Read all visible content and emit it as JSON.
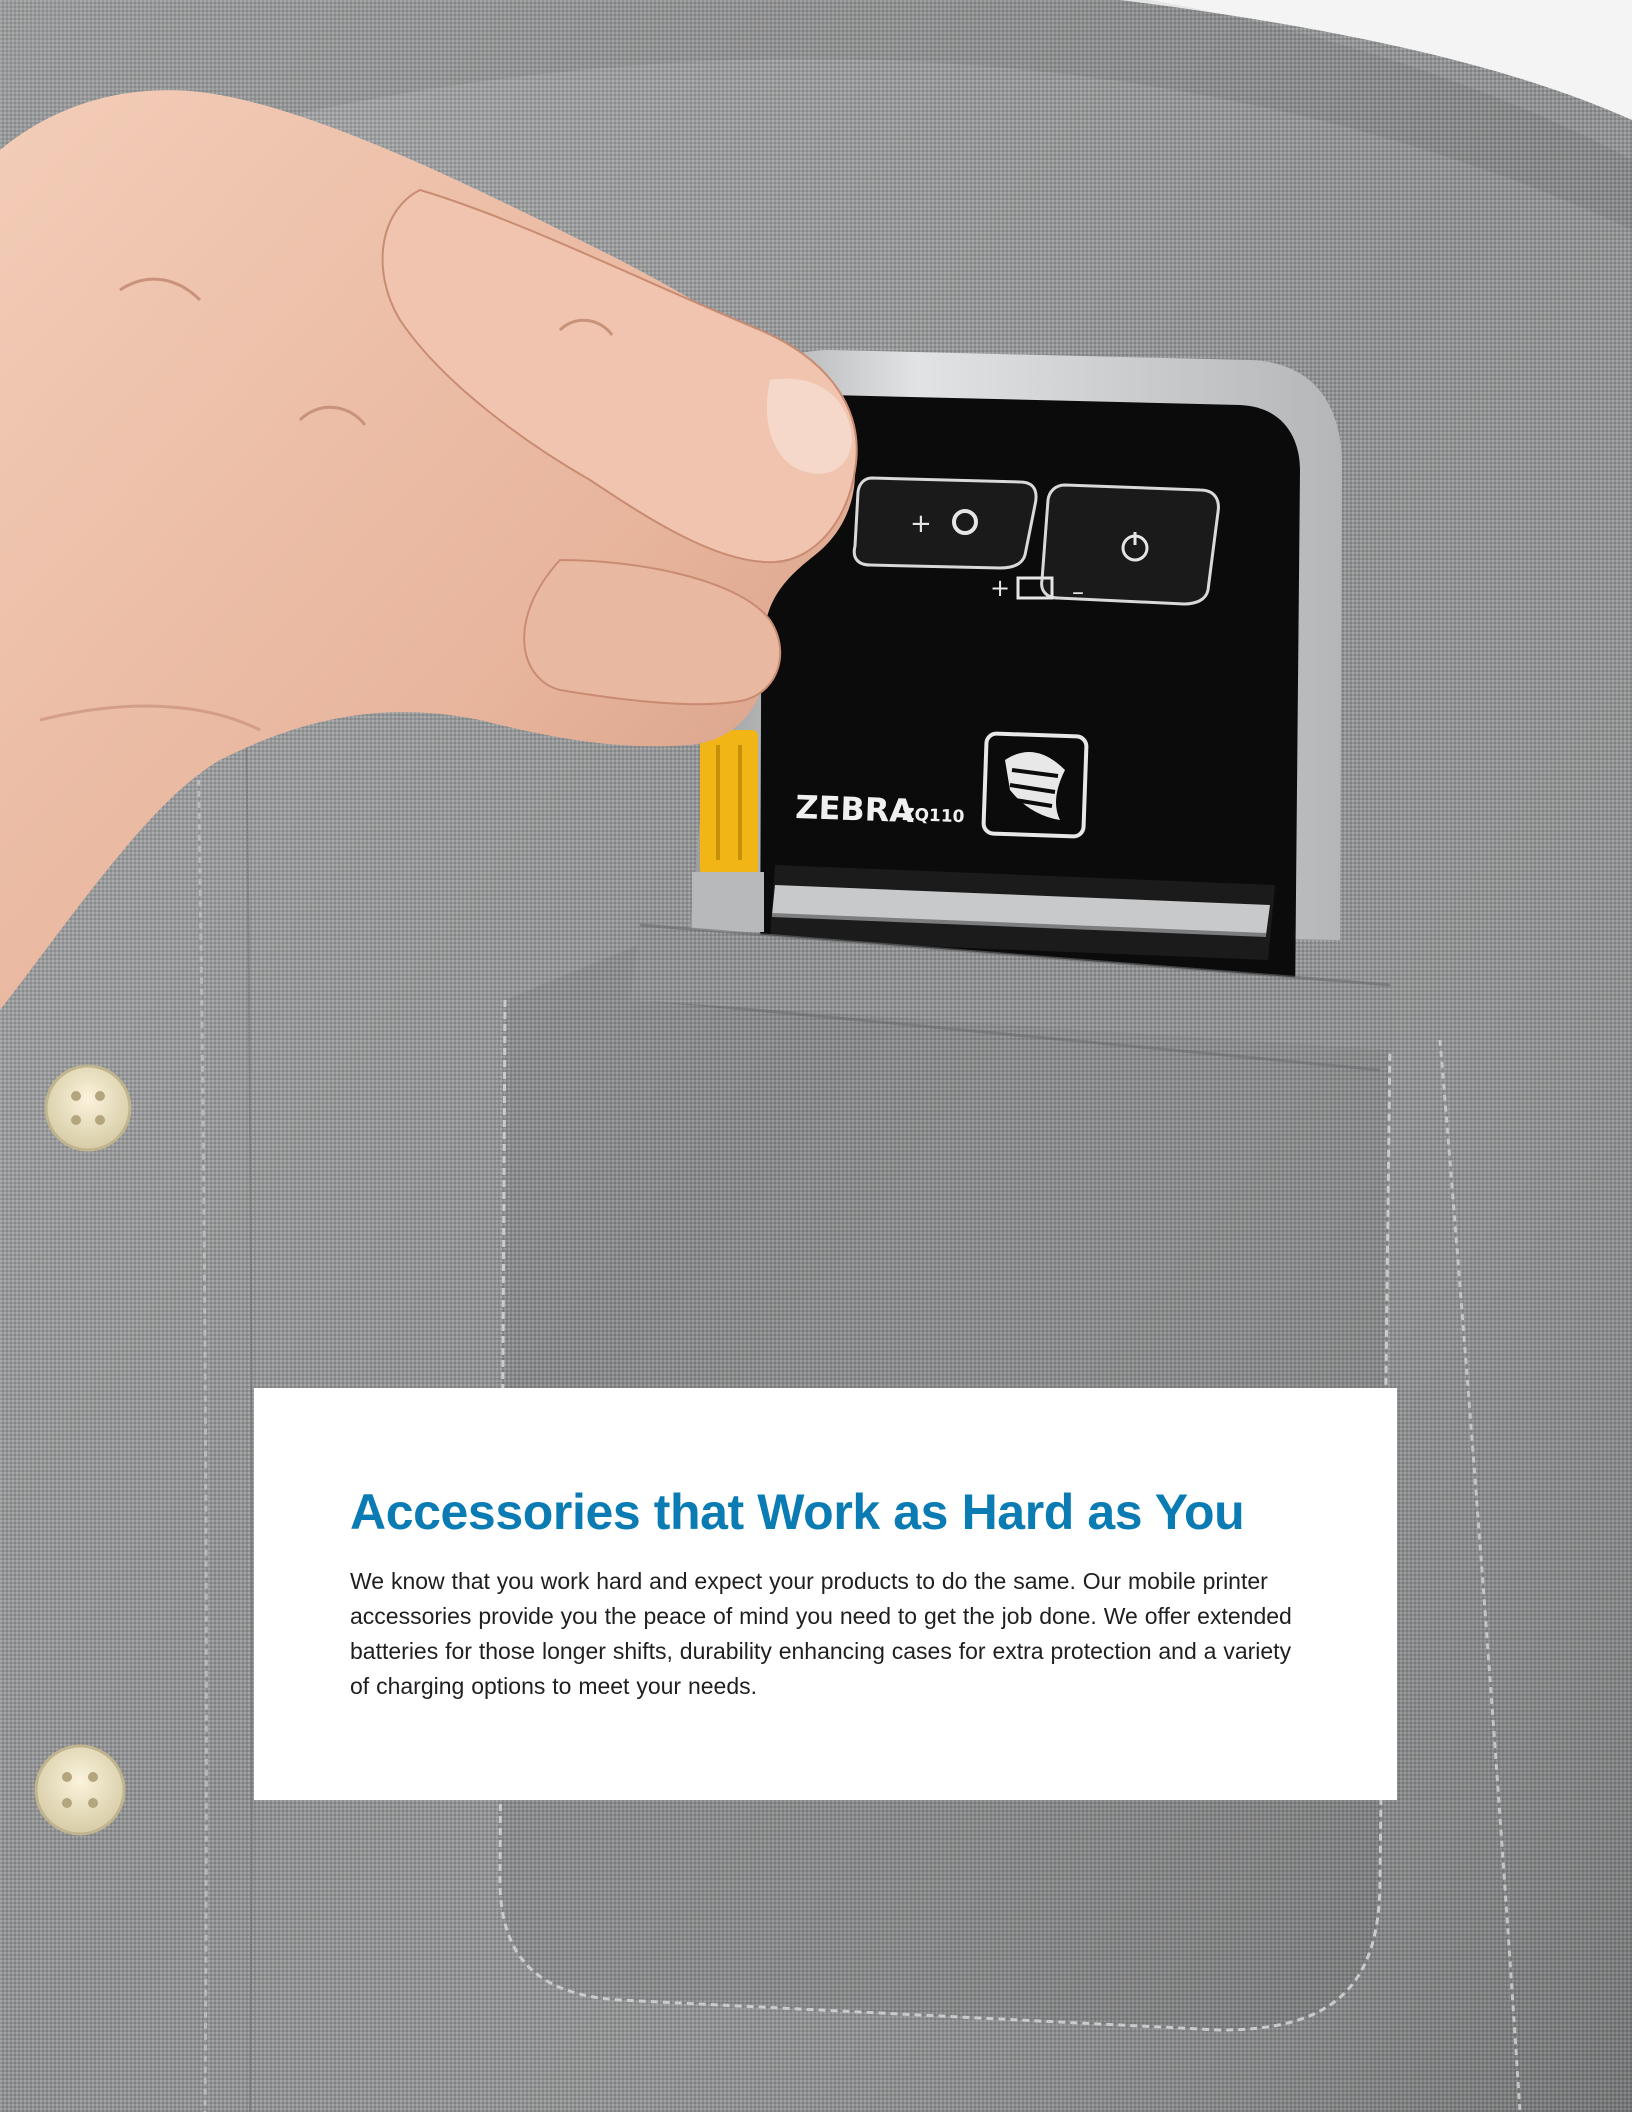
{
  "photo": {
    "printer_brand": "ZEBRA",
    "printer_model": "ZQ110"
  },
  "card": {
    "heading": "Accessories that Work as Hard as You",
    "body": "We know that you work hard and expect your products to do the same.  Our mobile printer accessories provide you the peace of mind you need to get the job done.  We offer extended batteries for those longer shifts, durability enhancing cases for extra protection and a variety of charging options to meet your needs."
  },
  "colors": {
    "heading": "#0a7cb3",
    "shirt": "#8f9192",
    "printer_accent": "#f2b516"
  }
}
